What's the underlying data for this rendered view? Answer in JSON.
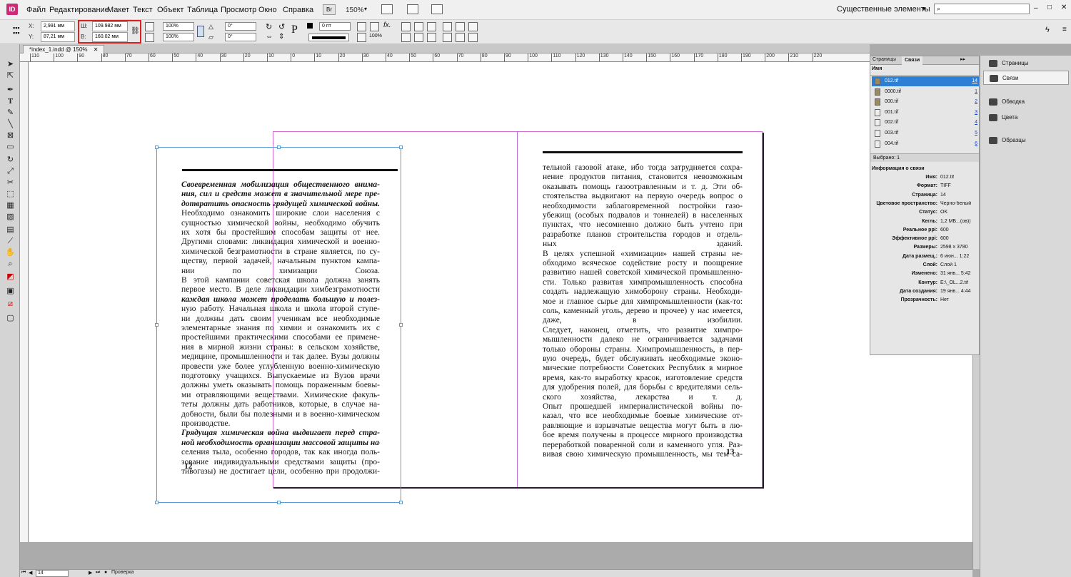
{
  "app": {
    "icon": "ID",
    "title_doc": "*index_1.indd @ 150%"
  },
  "menu": [
    "Файл",
    "Редактирование",
    "Макет",
    "Текст",
    "Объект",
    "Таблица",
    "Просмотр",
    "Окно",
    "Справка"
  ],
  "bridge": "Br",
  "zoom": "150%",
  "workspace": "Существенные элементы",
  "search_placeholder": "",
  "control": {
    "x": "2,991 мм",
    "y": "87,21 мм",
    "w": "109.982 мм",
    "h": "160.02 мм",
    "scale_x": "100%",
    "scale_y": "100%",
    "angle": "0°",
    "shear": "0°",
    "stroke": "0 пт",
    "opacity": "100%",
    "x_label": "X:",
    "y_label": "Y:",
    "w_label": "Ш:",
    "h_label": "В:"
  },
  "ruler": [
    "110",
    "100",
    "90",
    "80",
    "70",
    "60",
    "50",
    "40",
    "30",
    "20",
    "10",
    "0",
    "10",
    "20",
    "30",
    "40",
    "50",
    "60",
    "70",
    "80",
    "90",
    "100",
    "110",
    "120",
    "130",
    "140",
    "150",
    "160",
    "170",
    "180",
    "190",
    "200",
    "210",
    "220"
  ],
  "left_page": {
    "lines": [
      {
        "t": "Своевременная мобилизация общественного внима-",
        "i": true
      },
      {
        "t": "ния, сил и средств может в значительной мере пре-",
        "i": true
      },
      {
        "t": "дотвратить опасность грядущей химической войны.",
        "i": true
      },
      {
        "t": "Необходимо ознакомить широкие слои населения с"
      },
      {
        "t": "сущностью химической войны, необходимо обучить"
      },
      {
        "t": "их хотя бы простейшим способам защиты от нее."
      },
      {
        "t": "Другими словами: ликвидация химической и военно-"
      },
      {
        "t": "химической безграмотности в стране является, по су-"
      },
      {
        "t": "ществу, первой задачей, начальным пунктом кампа-"
      },
      {
        "t": "нии по химизации Союза."
      },
      {
        "t": "В этой кампании советская школа должна занять"
      },
      {
        "t": "первое место. В деле ликвидации химбезграмотности"
      },
      {
        "t": "каждая школа может проделать большую и полез-",
        "i": true
      },
      {
        "t": "ную работу. Начальная школа и школа второй ступе-"
      },
      {
        "t": "ни должны дать своим ученикам все необходимые"
      },
      {
        "t": "элементарные знания по химии и ознакомить их с"
      },
      {
        "t": "простейшими практическими способами ее примене-"
      },
      {
        "t": "ния в мирной жизни страны: в сельском хозяйстве,"
      },
      {
        "t": "медицине, промышленности и так далее. Вузы должны"
      },
      {
        "t": "провести уже более углубленную военно-химическую"
      },
      {
        "t": "подготовку учащихся. Выпускаемые из Вузов врачи"
      },
      {
        "t": "должны уметь оказывать помощь пораженным боевы-"
      },
      {
        "t": "ми отравляющими веществами. Химические факуль-"
      },
      {
        "t": "теты должны дать работников, которые, в случае на-"
      },
      {
        "t": "добности, были бы полезными и в военно-химическом"
      },
      {
        "t": "производстве."
      },
      {
        "t": "Грядущая химическая война выдвигает перед стра-",
        "i": true
      },
      {
        "t": "ной необходимость организации массовой защиты на-",
        "i": true
      },
      {
        "t": "селения тыла, особенно городов, так как иногда поль-"
      },
      {
        "t": "зование индивидуальными средствами защиты (про-"
      },
      {
        "t": "тивогазы) не достигает цели, особенно при продолжи-"
      }
    ],
    "page_number": "12"
  },
  "right_page": {
    "lines": [
      {
        "t": "тельной газовой атаке, ибо тогда затрудняется сохра-"
      },
      {
        "t": "нение продуктов питания, становится невозможным"
      },
      {
        "t": "оказывать помощь газоотравленным и т. д. Эти об-"
      },
      {
        "t": "стоятельства выдвигают на первую очередь вопрос о"
      },
      {
        "t": "необходимости заблаговременной постройки газо-"
      },
      {
        "t": "убежищ (особых подвалов и тоннелей) в населенных"
      },
      {
        "t": "пунктах, что несомненно должно быть учтено при"
      },
      {
        "t": "разработке планов строительства городов и отдель-"
      },
      {
        "t": "ных зданий."
      },
      {
        "t": "В целях успешной «химизации» нашей страны не-"
      },
      {
        "t": "обходимо всяческое содействие росту и поощрение"
      },
      {
        "t": "развитию нашей советской химической промышленно-"
      },
      {
        "t": "сти. Только развитая химпромышленность способна"
      },
      {
        "t": "создать надлежащую химоборону страны. Необходи-"
      },
      {
        "t": "мое и главное сырье для химпромышленности (как-то:"
      },
      {
        "t": "соль, каменный уголь, дерево и прочее) у нас имеется,"
      },
      {
        "t": "даже, в изобилии."
      },
      {
        "t": "Следует, наконец, отметить, что развитие химпро-"
      },
      {
        "t": "мышленности далеко не ограничивается задачами"
      },
      {
        "t": "только обороны страны. Химпромышленность, в пер-"
      },
      {
        "t": "вую очередь, будет обслуживать необходимые эконо-"
      },
      {
        "t": "мические потребности Советских Республик в мирное"
      },
      {
        "t": "время, как-то выработку красок, изготовление средств"
      },
      {
        "t": "для удобрения полей, для борьбы с вредителями сель-"
      },
      {
        "t": "ского хозяйства, лекарства и т. д."
      },
      {
        "t": "Опыт прошедшей империалистической войны по-"
      },
      {
        "t": "казал, что все необходимые боевые химические от-"
      },
      {
        "t": "равляющие и взрывчатые вещества могут быть в лю-"
      },
      {
        "t": "бое время получены в процессе мирного производства"
      },
      {
        "t": "переработкой поваренной соли и каменного угля. Раз-"
      },
      {
        "t": "вивая свою химическую промышленность, мы тем са-"
      }
    ],
    "page_number": "13"
  },
  "links_panel": {
    "tabs": [
      "Страницы",
      "Связи"
    ],
    "col_name": "Имя",
    "rows": [
      {
        "name": "012.tif",
        "page": "14"
      },
      {
        "name": "0000.tif",
        "page": "1"
      },
      {
        "name": "000.tif",
        "page": "2"
      },
      {
        "name": "001.tif",
        "page": "3"
      },
      {
        "name": "002.tif",
        "page": "4"
      },
      {
        "name": "003.tif",
        "page": "5"
      },
      {
        "name": "004.tif",
        "page": "6"
      }
    ],
    "selected": "Выбрано: 1",
    "info_title": "Информация о связи",
    "info": [
      {
        "k": "Имя:",
        "v": "012.tif"
      },
      {
        "k": "Формат:",
        "v": "TIFF"
      },
      {
        "k": "Страница:",
        "v": "14"
      },
      {
        "k": "Цветовое пространство:",
        "v": "Черно-белый"
      },
      {
        "k": "Статус:",
        "v": "OK"
      },
      {
        "k": "Кегль:",
        "v": "1,2 МБ...(ов))"
      },
      {
        "k": "Реальное ppi:",
        "v": "600"
      },
      {
        "k": "Эффективное ppi:",
        "v": "600"
      },
      {
        "k": "Размеры:",
        "v": "2598 x 3780"
      },
      {
        "k": "Дата размещ.:",
        "v": "6 июн... 1:22"
      },
      {
        "k": "Слой:",
        "v": "Слой 1"
      },
      {
        "k": "Изменено:",
        "v": "31 янв... 5:42"
      },
      {
        "k": "Контур:",
        "v": "E:\\_OL...2.tif"
      },
      {
        "k": "Дата создания:",
        "v": "19 янв... 4:44"
      },
      {
        "k": "Прозрачность:",
        "v": "Нет"
      }
    ]
  },
  "dock": [
    "Страницы",
    "Связи",
    "Обводка",
    "Цвета",
    "Образцы"
  ],
  "status": {
    "page": "14",
    "preflight": "Проверка"
  }
}
